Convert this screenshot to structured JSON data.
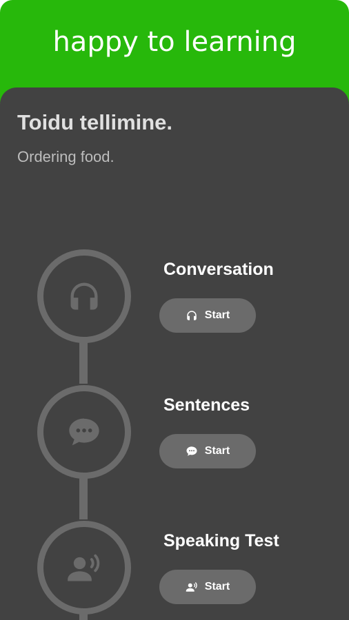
{
  "header": {
    "title": "happy to learning"
  },
  "lesson": {
    "title": "Toidu tellimine.",
    "subtitle": "Ordering food."
  },
  "steps": [
    {
      "title": "Conversation",
      "button_label": "Start",
      "icon": "headphones-icon"
    },
    {
      "title": "Sentences",
      "button_label": "Start",
      "icon": "chat-bubble-icon"
    },
    {
      "title": "Speaking Test",
      "button_label": "Start",
      "icon": "speaking-person-icon"
    }
  ],
  "colors": {
    "header_bg": "#27b80b",
    "card_bg": "#424242",
    "step_accent": "#6b6b6b"
  }
}
